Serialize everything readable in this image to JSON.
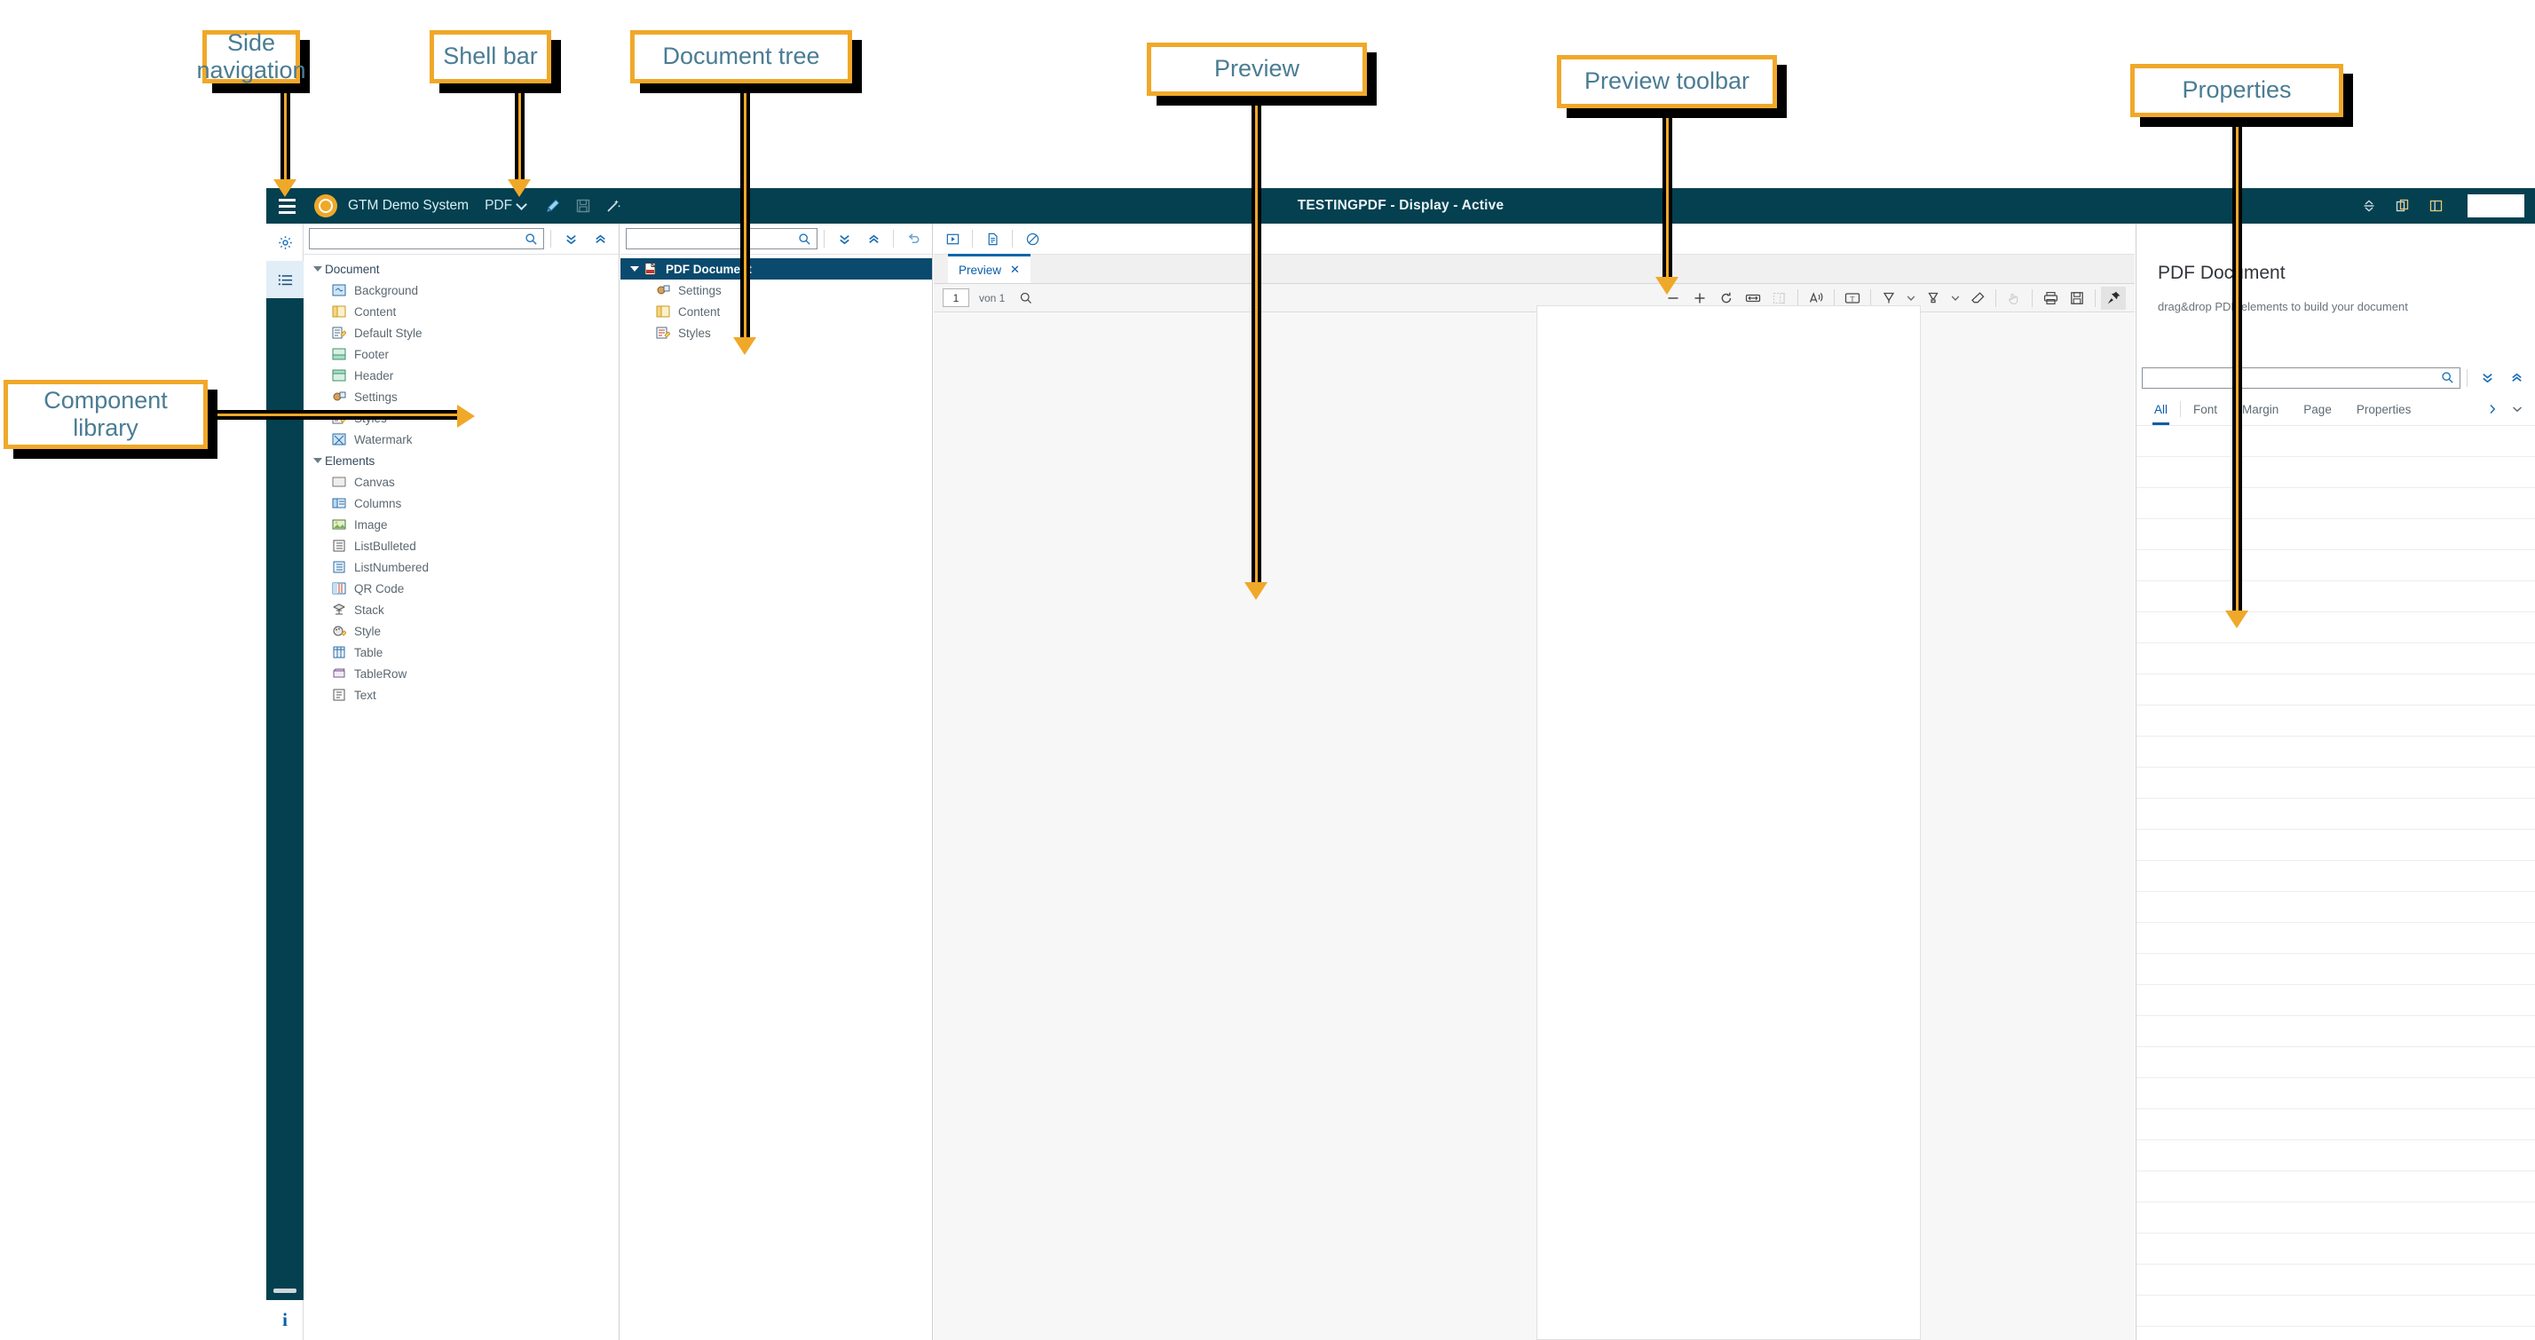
{
  "annotations": [
    {
      "id": "side-navigation",
      "label": "Side\nnavigation"
    },
    {
      "id": "shell-bar",
      "label": "Shell bar"
    },
    {
      "id": "document-tree",
      "label": "Document tree"
    },
    {
      "id": "preview",
      "label": "Preview"
    },
    {
      "id": "preview-toolbar",
      "label": "Preview toolbar"
    },
    {
      "id": "properties",
      "label": "Properties"
    },
    {
      "id": "component-library",
      "label": "Component\nlibrary"
    }
  ],
  "annotation_text": {
    "side_nav_l1": "Side",
    "side_nav_l2": "navigation",
    "shell_bar": "Shell bar",
    "document_tree": "Document tree",
    "preview": "Preview",
    "preview_toolbar": "Preview toolbar",
    "properties": "Properties",
    "component_library_l1": "Component",
    "component_library_l2": "library"
  },
  "shellbar": {
    "product": "GTM Demo System",
    "app": "PDF",
    "title": "TESTINGPDF - Display - Active",
    "icons": [
      "menu-icon",
      "edit-pencil-icon",
      "save-icon",
      "magic-wand-icon",
      "expand-collapse-icon",
      "duplicate-icon",
      "split-view-icon"
    ]
  },
  "sidenav": {
    "items": [
      {
        "name": "settings-gear-icon",
        "active": false
      },
      {
        "name": "list-outline-icon",
        "active": true
      }
    ],
    "info_label": "i"
  },
  "library": {
    "search_placeholder": "",
    "search_value": "",
    "expand_label": "expand-all-icon",
    "collapse_label": "collapse-all-icon",
    "groups": [
      {
        "label": "Document",
        "items": [
          {
            "label": "Background",
            "icon": "background-icon"
          },
          {
            "label": "Content",
            "icon": "content-icon"
          },
          {
            "label": "Default Style",
            "icon": "default-style-icon"
          },
          {
            "label": "Footer",
            "icon": "footer-icon"
          },
          {
            "label": "Header",
            "icon": "header-icon"
          },
          {
            "label": "Settings",
            "icon": "settings-icon"
          },
          {
            "label": "Styles",
            "icon": "styles-icon"
          },
          {
            "label": "Watermark",
            "icon": "watermark-icon"
          }
        ]
      },
      {
        "label": "Elements",
        "items": [
          {
            "label": "Canvas",
            "icon": "canvas-icon"
          },
          {
            "label": "Columns",
            "icon": "columns-icon"
          },
          {
            "label": "Image",
            "icon": "image-icon"
          },
          {
            "label": "ListBulleted",
            "icon": "list-bulleted-icon"
          },
          {
            "label": "ListNumbered",
            "icon": "list-numbered-icon"
          },
          {
            "label": "QR Code",
            "icon": "qr-code-icon"
          },
          {
            "label": "Stack",
            "icon": "stack-icon"
          },
          {
            "label": "Style",
            "icon": "style-icon"
          },
          {
            "label": "Table",
            "icon": "table-icon"
          },
          {
            "label": "TableRow",
            "icon": "table-row-icon"
          },
          {
            "label": "Text",
            "icon": "text-icon"
          }
        ]
      }
    ]
  },
  "doctree": {
    "search_value": "",
    "root": {
      "label": "PDF Document",
      "icon": "pdf-document-icon",
      "selected": true
    },
    "children": [
      {
        "label": "Settings",
        "icon": "settings-icon"
      },
      {
        "label": "Content",
        "icon": "content-icon"
      },
      {
        "label": "Styles",
        "icon": "styles-icon"
      }
    ]
  },
  "preview": {
    "actions": [
      "run-icon",
      "new-document-icon",
      "cancel-icon"
    ],
    "tab_label": "Preview",
    "tab_close": "✕",
    "page_value": "1",
    "page_of": "von 1",
    "toolbar_icons": [
      "search-icon",
      "zoom-out-icon",
      "zoom-in-icon",
      "rotate-icon",
      "fit-width-icon",
      "page-view-icon",
      "read-aloud-icon",
      "text-select-icon",
      "pen-icon",
      "pen-dropdown-icon",
      "highlighter-icon",
      "highlighter-dropdown-icon",
      "eraser-icon",
      "hand-icon",
      "print-icon",
      "save-icon",
      "pin-icon"
    ]
  },
  "properties": {
    "title": "PDF Document",
    "subtitle": "drag&drop PDF elements to build your document",
    "search_value": "",
    "tabs": [
      {
        "label": "All",
        "selected": true
      },
      {
        "label": "Font",
        "selected": false
      },
      {
        "label": "Margin",
        "selected": false
      },
      {
        "label": "Page",
        "selected": false
      },
      {
        "label": "Properties",
        "selected": false
      }
    ],
    "overflow_icons": [
      "next-arrow-icon",
      "more-chevron-icon"
    ]
  },
  "colors": {
    "shell_bg": "#04404f",
    "accent_orange": "#F0A829",
    "selected_tree": "#0a4a6e",
    "link_blue": "#0a5ca8",
    "callout_text": "#4a7c93"
  }
}
